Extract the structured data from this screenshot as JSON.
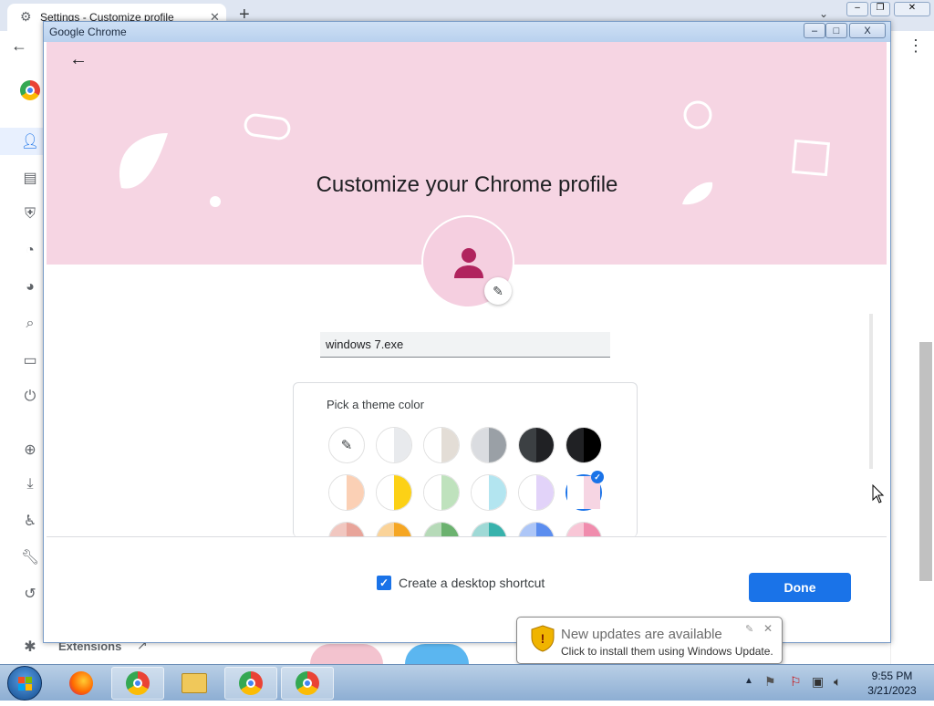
{
  "background": {
    "tab_title": "Settings - Customize profile",
    "sidebar_extensions_label": "Extensions"
  },
  "dialog": {
    "window_title": "Google Chrome",
    "heading": "Customize your Chrome profile",
    "profile_name": "windows 7.exe",
    "theme_label": "Pick a theme color",
    "shortcut_label": "Create a desktop shortcut",
    "shortcut_checked": true,
    "done_label": "Done",
    "window_buttons": [
      "–",
      "□",
      "X"
    ],
    "hero_color": "#f6d5e3",
    "accent_color": "#1a73e8",
    "avatar_icon_color": "#b0245e",
    "theme_swatches": [
      [
        "eyedropper",
        "#e8eaed|#ffffff",
        "#e3ddd6|#ffffff",
        "#9aa0a6|#dadce0",
        "#202124|#3c4043",
        "#000000|#202124"
      ],
      [
        "#fbd0b5|#ffffff",
        "#fcd116|#ffffff",
        "#bfe2bd|#ffffff",
        "#b3e5f0|#ffffff",
        "#e2d3f9|#ffffff",
        "#f6d5e3|#ffffff"
      ],
      [
        "#e8a49a|#f1c7c0",
        "#f5a623|#fad399",
        "#6bb26f|#b6dab8",
        "#38b2ac|#9fd9d6",
        "#5b8def|#adc6f7",
        "#f08cad|#f8c6d6"
      ]
    ],
    "selected_swatch": "row2-col6"
  },
  "notification": {
    "title": "New updates are available",
    "body": "Click to install them using Windows Update."
  },
  "taskbar": {
    "time": "9:55 PM",
    "date": "3/21/2023"
  }
}
